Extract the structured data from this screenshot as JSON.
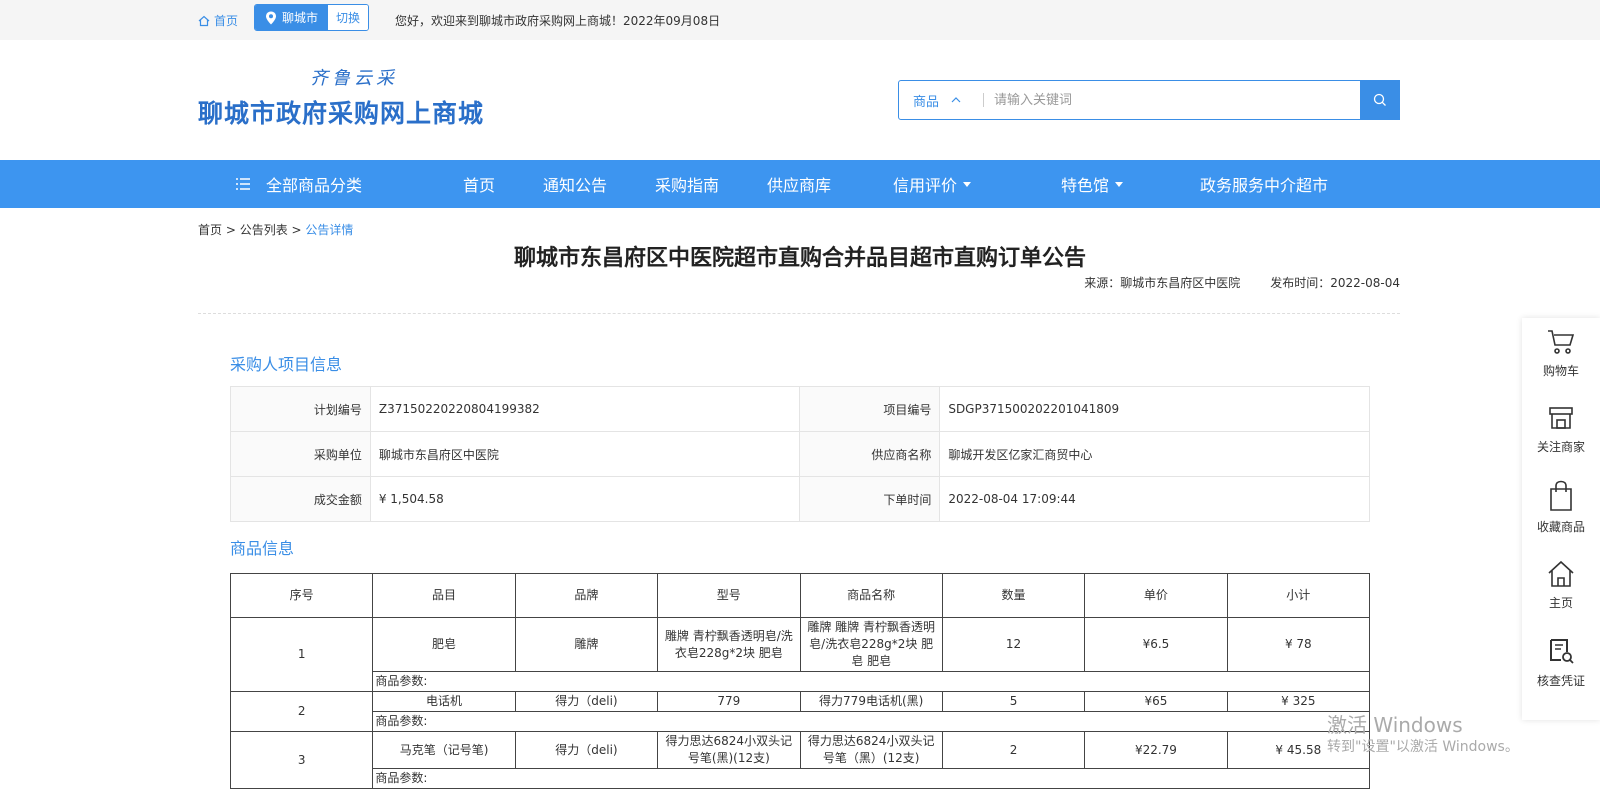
{
  "topbar": {
    "home": "首页",
    "city": "聊城市",
    "switch": "切换",
    "welcome": "您好，欢迎来到聊城市政府采购网上商城！2022年09月08日"
  },
  "logo": {
    "sub": "齐鲁云采",
    "main": "聊城市政府采购网上商城"
  },
  "search": {
    "category": "商品",
    "placeholder": "请输入关键词"
  },
  "nav": {
    "all_categories": "全部商品分类",
    "items": [
      "首页",
      "通知公告",
      "采购指南",
      "供应商库",
      "信用评价",
      "特色馆",
      "政务服务中介超市"
    ]
  },
  "breadcrumb": {
    "home": "首页",
    "list": "公告列表",
    "current": "公告详情",
    "sep": " > "
  },
  "notice": {
    "title": "聊城市东昌府区中医院超市直购合并品目超市直购订单公告",
    "source": "来源：聊城市东昌府区中医院",
    "publish": "发布时间：2022-08-04"
  },
  "buyer_info": {
    "section_title": "采购人项目信息",
    "rows": [
      [
        "计划编号",
        "Z37150220220804199382",
        "项目编号",
        "SDGP371500202201041809"
      ],
      [
        "采购单位",
        "聊城市东昌府区中医院",
        "供应商名称",
        "聊城开发区亿家汇商贸中心"
      ],
      [
        "成交金额",
        "¥ 1,504.58",
        "下单时间",
        "2022-08-04 17:09:44"
      ]
    ]
  },
  "goods": {
    "section_title": "商品信息",
    "headers": [
      "序号",
      "品目",
      "品牌",
      "型号",
      "商品名称",
      "数量",
      "单价",
      "小计"
    ],
    "param_label": "商品参数:",
    "rows": [
      [
        "1",
        "肥皂",
        "雕牌",
        "雕牌 青柠飘香透明皂/洗衣皂228g*2块 肥皂",
        "雕牌 雕牌 青柠飘香透明皂/洗衣皂228g*2块 肥皂 肥皂",
        "12",
        "¥6.5",
        "¥ 78"
      ],
      [
        "2",
        "电话机",
        "得力（deli)",
        "779",
        "得力779电话机(黑)",
        "5",
        "¥65",
        "¥ 325"
      ],
      [
        "3",
        "马克笔（记号笔)",
        "得力（deli)",
        "得力思达6824小双头记号笔(黑)(12支)",
        "得力思达6824小双头记号笔（黑）(12支)",
        "2",
        "¥22.79",
        "¥ 45.58"
      ]
    ]
  },
  "sidebar": [
    "购物车",
    "关注商家",
    "收藏商品",
    "主页",
    "核查凭证"
  ],
  "watermark": {
    "line1": "激活 Windows",
    "line2": "转到\"设置\"以激活 Windows。"
  }
}
